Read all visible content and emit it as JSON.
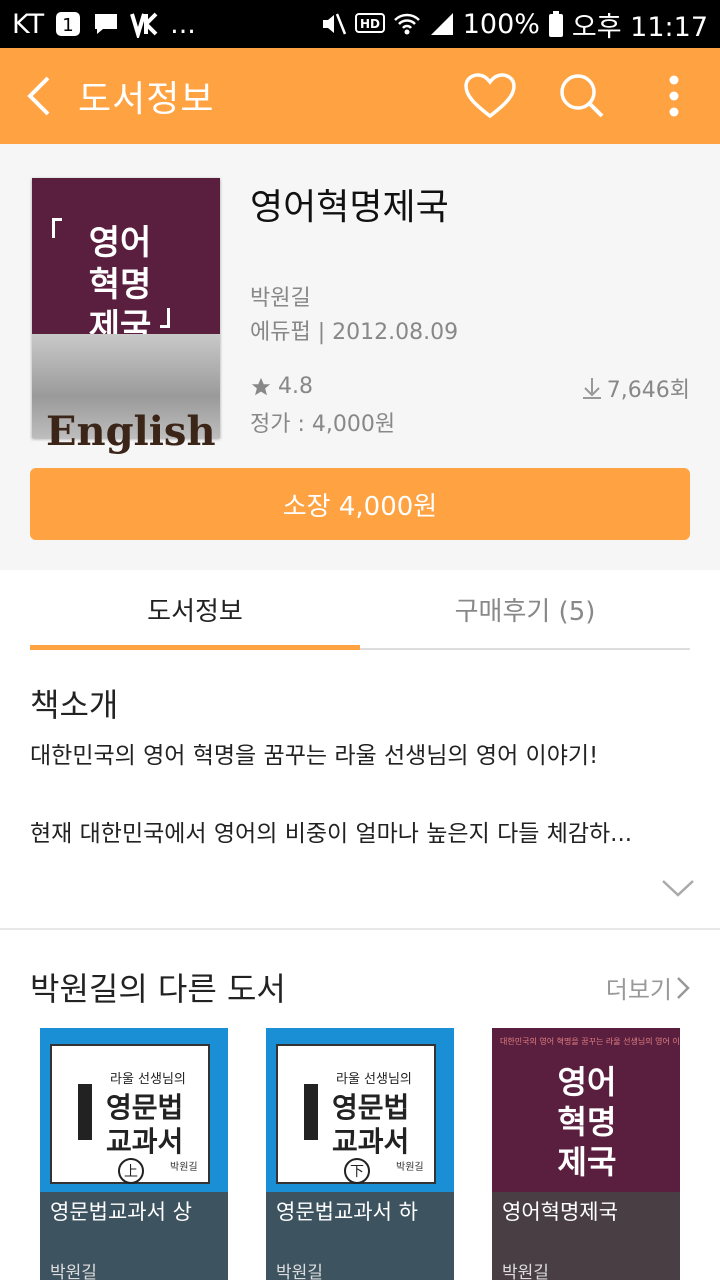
{
  "status_bar": {
    "carrier": "KT",
    "more": "...",
    "battery": "100%",
    "time": "오후 11:17",
    "hd_label": "HD"
  },
  "app_bar": {
    "title": "도서정보"
  },
  "book": {
    "cover_title": "영어\n혁명\n제국",
    "cover_english": "English",
    "title": "영어혁명제국",
    "author": "박원길",
    "publisher_date": "에듀펍 | 2012.08.09",
    "rating": "4.8",
    "price": "정가 : 4,000원",
    "downloads": "7,646회"
  },
  "buy_button": "소장 4,000원",
  "tabs": [
    {
      "label": "도서정보",
      "active": true
    },
    {
      "label": "구매후기 (5)",
      "active": false
    }
  ],
  "intro": {
    "heading": "책소개",
    "line1": "대한민국의 영어 혁명을 꿈꾸는 라울 선생님의 영어 이야기!",
    "line2": "현재 대한민국에서 영어의 비중이 얼마나 높은지 다들 체감하..."
  },
  "other_books": {
    "heading": "박원길의 다른 도서",
    "more_label": "더보기",
    "items": [
      {
        "title": "영문법교과서 상",
        "author": "박원길",
        "cover_line1": "라울 선생님의",
        "cover_line2": "영문법",
        "cover_line3": "교과서",
        "cover_badge": "上",
        "cover_author": "박원길"
      },
      {
        "title": "영문법교과서 하",
        "author": "박원길",
        "cover_line1": "라울 선생님의",
        "cover_line2": "영문법",
        "cover_line3": "교과서",
        "cover_badge": "下",
        "cover_author": "박원길"
      },
      {
        "title": "영어혁명제국",
        "author": "박원길",
        "cover_title": "영어\n혁명\n제국",
        "cover_small": "대한민국의 영어 혁명을 꿈꾸는 라울 선생님의 영어 이야기"
      }
    ]
  },
  "colors": {
    "accent": "#ffa241",
    "cover_wine": "#5a1e3f",
    "grammar_blue": "#1a8fd6"
  }
}
